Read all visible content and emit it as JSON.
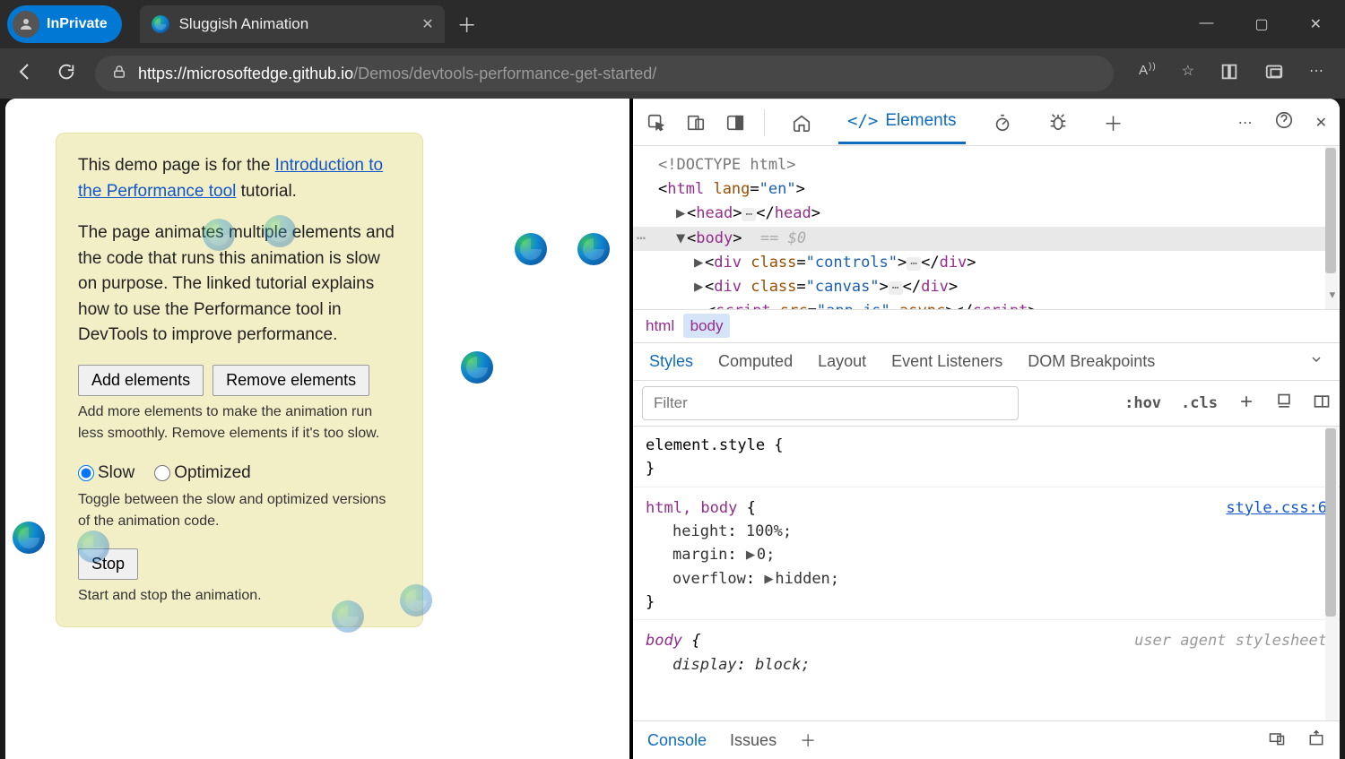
{
  "browser": {
    "inprivate_label": "InPrivate",
    "tab_title": "Sluggish Animation",
    "url_host": "https://microsoftedge.github.io",
    "url_path": "/Demos/devtools-performance-get-started/"
  },
  "page": {
    "intro_prefix": "This demo page is for the ",
    "intro_link": "Introduction to the Performance tool",
    "intro_suffix": " tutorial.",
    "description": "The page animates multiple elements and the code that runs this animation is slow on purpose. The linked tutorial explains how to use the Performance tool in DevTools to improve performance.",
    "add_btn": "Add elements",
    "remove_btn": "Remove elements",
    "add_help": "Add more elements to make the animation run less smoothly. Remove elements if it's too slow.",
    "radio_slow": "Slow",
    "radio_optimized": "Optimized",
    "radio_help": "Toggle between the slow and optimized versions of the animation code.",
    "stop_btn": "Stop",
    "stop_help": "Start and stop the animation."
  },
  "devtools": {
    "elements_tab": "Elements",
    "dom": {
      "doctype": "<!DOCTYPE html>",
      "html_open": "html",
      "html_lang_attr": "lang",
      "html_lang_val": "\"en\"",
      "head": "head",
      "body": "body",
      "body_eq": "== $0",
      "div1_class": "\"controls\"",
      "div2_class": "\"canvas\"",
      "script_src": "\"app.js\"",
      "script_async": "async"
    },
    "crumbs": {
      "html": "html",
      "body": "body"
    },
    "style_tabs": {
      "styles": "Styles",
      "computed": "Computed",
      "layout": "Layout",
      "events": "Event Listeners",
      "dombp": "DOM Breakpoints"
    },
    "filter_placeholder": "Filter",
    "hov": ":hov",
    "cls": ".cls",
    "rules": {
      "elstyle": "element.style {",
      "close": "}",
      "htmlbody_sel": "html, body",
      "open_brace": " {",
      "src": "style.css:6",
      "height_k": "height",
      "height_v": "100%;",
      "margin_k": "margin",
      "margin_v": "0;",
      "overflow_k": "overflow",
      "overflow_v": "hidden;",
      "body_sel": "body",
      "ua_label": "user agent stylesheet",
      "display_k": "display",
      "display_v": "block;"
    },
    "drawer": {
      "console": "Console",
      "issues": "Issues"
    }
  }
}
